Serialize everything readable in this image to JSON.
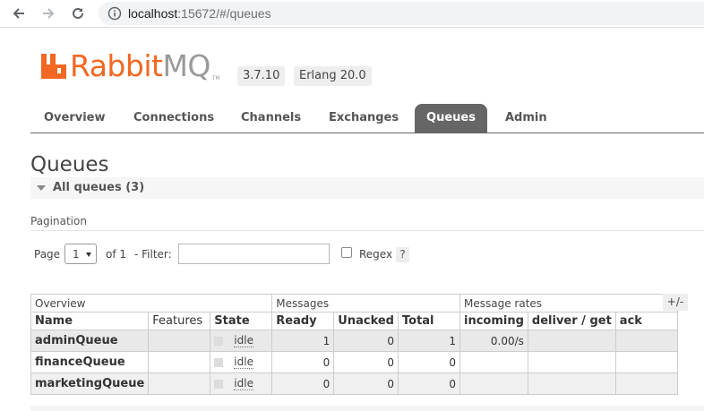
{
  "browser": {
    "url_host": "localhost",
    "url_path": ":15672/#/queues",
    "back_icon": "back-arrow-icon",
    "forward_icon": "forward-arrow-icon",
    "reload_icon": "reload-icon",
    "info_icon": "info-icon"
  },
  "header": {
    "logo_rabbit": "Rabbit",
    "logo_mq": "MQ",
    "logo_tm": "TM",
    "version": "3.7.10",
    "erlang": "Erlang 20.0",
    "brand_color": "#f26822"
  },
  "tabs": [
    {
      "label": "Overview"
    },
    {
      "label": "Connections"
    },
    {
      "label": "Channels"
    },
    {
      "label": "Exchanges"
    },
    {
      "label": "Queues",
      "active": true
    },
    {
      "label": "Admin"
    }
  ],
  "page": {
    "title": "Queues",
    "section_label": "All queues (3)"
  },
  "pagination": {
    "heading": "Pagination",
    "page_label": "Page",
    "page_value": "1",
    "of_label": "of 1",
    "filter_label": "- Filter:",
    "filter_value": "",
    "regex_label": "Regex",
    "regex_checked": false,
    "help": "?"
  },
  "table": {
    "groups": [
      "Overview",
      "Messages",
      "Message rates"
    ],
    "columns": [
      "Name",
      "Features",
      "State",
      "Ready",
      "Unacked",
      "Total",
      "incoming",
      "deliver / get",
      "ack"
    ],
    "rows": [
      {
        "name": "adminQueue",
        "features": "",
        "state": "idle",
        "ready": "1",
        "unacked": "0",
        "total": "1",
        "incoming": "0.00/s",
        "deliver": "",
        "ack": ""
      },
      {
        "name": "financeQueue",
        "features": "",
        "state": "idle",
        "ready": "0",
        "unacked": "0",
        "total": "0",
        "incoming": "",
        "deliver": "",
        "ack": ""
      },
      {
        "name": "marketingQueue",
        "features": "",
        "state": "idle",
        "ready": "0",
        "unacked": "0",
        "total": "0",
        "incoming": "",
        "deliver": "",
        "ack": ""
      }
    ],
    "columns_toggle": "+/-"
  }
}
